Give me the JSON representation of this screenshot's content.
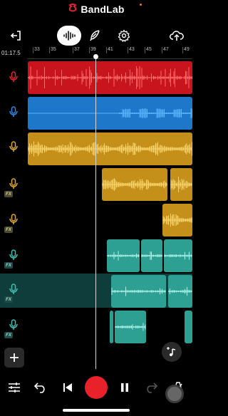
{
  "app": {
    "brand_name": "BandLab"
  },
  "colors": {
    "brand_red": "#e8212b",
    "track_red": "#c8151d",
    "track_blue": "#1f77c9",
    "track_yellow": "#c5901a",
    "track_teal": "#2e9f93",
    "selected_row": "#0e3d3b"
  },
  "toolbar": {
    "back_icon": "exit-icon",
    "waveform_icon": "waveform-icon",
    "feather_icon": "feather-icon",
    "settings_icon": "gear-icon",
    "upload_icon": "cloud-upload-icon"
  },
  "ruler": {
    "time": "01:17.5",
    "marks": [
      "33",
      "35",
      "37",
      "39",
      "41",
      "43",
      "45",
      "47",
      "49"
    ]
  },
  "tracks": [
    {
      "fx": false,
      "color": "red"
    },
    {
      "fx": false,
      "color": "blue"
    },
    {
      "fx": false,
      "color": "yellow"
    },
    {
      "fx": true,
      "fx_label": "FX",
      "color": "yellow"
    },
    {
      "fx": true,
      "fx_label": "FX",
      "color": "yellow"
    },
    {
      "fx": true,
      "fx_label": "FX",
      "color": "teal"
    },
    {
      "fx": true,
      "fx_label": "FX",
      "color": "teal",
      "selected": true
    },
    {
      "fx": true,
      "fx_label": "FX",
      "color": "teal"
    }
  ],
  "bottom": {
    "add_track_icon": "plus-icon",
    "add_instrument_icon": "music-note-plus-icon",
    "transport": [
      "mixer-icon",
      "undo-icon",
      "skip-back-icon",
      "record-button",
      "pause-icon",
      "redo-icon",
      "metronome-icon"
    ]
  }
}
